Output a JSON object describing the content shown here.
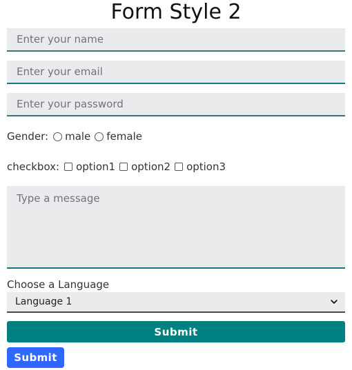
{
  "title": "Form Style 2",
  "fields": {
    "name": {
      "placeholder": "Enter your name",
      "value": ""
    },
    "email": {
      "placeholder": "Enter your email",
      "value": ""
    },
    "password": {
      "placeholder": "Enter your password",
      "value": ""
    }
  },
  "gender": {
    "label": "Gender:",
    "options": [
      {
        "label": "male",
        "checked": false
      },
      {
        "label": "female",
        "checked": false
      }
    ]
  },
  "checkbox": {
    "label": "checkbox:",
    "options": [
      {
        "label": "option1",
        "checked": false
      },
      {
        "label": "option2",
        "checked": false
      },
      {
        "label": "option3",
        "checked": false
      }
    ]
  },
  "message": {
    "placeholder": "Type a message",
    "value": ""
  },
  "language": {
    "label": "Choose a Language",
    "selected": "Language 1"
  },
  "buttons": {
    "form_submit": "Submit",
    "secondary_submit": "Submit"
  },
  "icons": {
    "select_arrow": "chevron-down-icon"
  },
  "colors": {
    "teal": "#008080",
    "blue": "#2F68FF",
    "field_background": "#E9EBED"
  }
}
